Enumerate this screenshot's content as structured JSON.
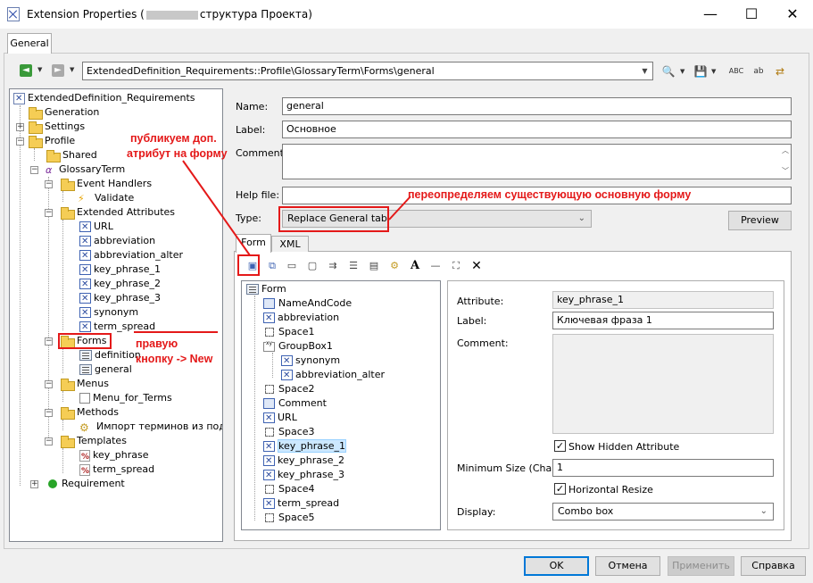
{
  "window": {
    "title_prefix": "Extension Properties (",
    "title_suffix": "структура Проекта)",
    "minimize": "—",
    "maximize": "☐",
    "close": "✕"
  },
  "tabs": {
    "general": "General"
  },
  "toolbar": {
    "path": "ExtendedDefinition_Requirements::Profile\\GlossaryTerm\\Forms\\general",
    "back_icon": "◄",
    "forward_icon": "►",
    "search_icon": "🔍",
    "save_icon": "💾",
    "spell_icon": "ABC",
    "abc_icon": "ab",
    "props_icon": "⇄"
  },
  "tree": {
    "root": "ExtendedDefinition_Requirements",
    "generation": "Generation",
    "settings": "Settings",
    "profile": "Profile",
    "shared": "Shared",
    "glossary_term": "GlossaryTerm",
    "event_handlers": "Event Handlers",
    "validate": "Validate",
    "extended_attributes": "Extended Attributes",
    "attributes": [
      "URL",
      "abbreviation",
      "abbreviation_alter",
      "key_phrase_1",
      "key_phrase_2",
      "key_phrase_3",
      "synonym",
      "term_spread"
    ],
    "forms": "Forms",
    "form_items": [
      "definition",
      "general"
    ],
    "menus": "Menus",
    "menu_items": [
      "Menu_for_Terms"
    ],
    "methods": "Methods",
    "method_items": [
      "Импорт терминов  из подго"
    ],
    "templates": "Templates",
    "template_items": [
      "key_phrase",
      "term_spread"
    ],
    "requirement": "Requirement"
  },
  "props": {
    "name_label": "Name:",
    "name_value": "general",
    "label_label": "Label:",
    "label_value": "Основное",
    "comment_label": "Comment:",
    "help_label": "Help file:",
    "help_value": "",
    "type_label": "Type:",
    "type_value": "Replace General tab",
    "preview": "Preview"
  },
  "subtabs": {
    "form": "Form",
    "xml": "XML"
  },
  "form_tree": {
    "root": "Form",
    "items": [
      "NameAndCode",
      "abbreviation",
      "Space1",
      "GroupBox1",
      "synonym",
      "abbreviation_alter",
      "Space2",
      "Comment",
      "URL",
      "Space3",
      "key_phrase_1",
      "key_phrase_2",
      "key_phrase_3",
      "Space4",
      "term_spread",
      "Space5"
    ]
  },
  "detail": {
    "attribute_label": "Attribute:",
    "attribute_value": "key_phrase_1",
    "label_label": "Label:",
    "label_value": "Ключевая фраза 1",
    "comment_label": "Comment:",
    "show_hidden": "Show Hidden Attribute",
    "show_hidden_checked": true,
    "min_size_label": "Minimum Size (Chars):",
    "min_size_value": "1",
    "horizontal_resize": "Horizontal Resize",
    "horizontal_resize_checked": true,
    "display_label": "Display:",
    "display_value": "Combo box"
  },
  "buttons": {
    "ok": "OK",
    "cancel": "Отмена",
    "apply": "Применить",
    "help": "Справка"
  },
  "annotations": {
    "publish_line1": "публикуем доп.",
    "publish_line2": "атрибут на форму",
    "right_click_line1": "правую",
    "right_click_line2": "кнопку -> New",
    "override": "переопределяем существующую основную форму"
  },
  "colors": {
    "annotation": "#e41919",
    "selection": "#cce8ff",
    "accent": "#0078d7"
  }
}
